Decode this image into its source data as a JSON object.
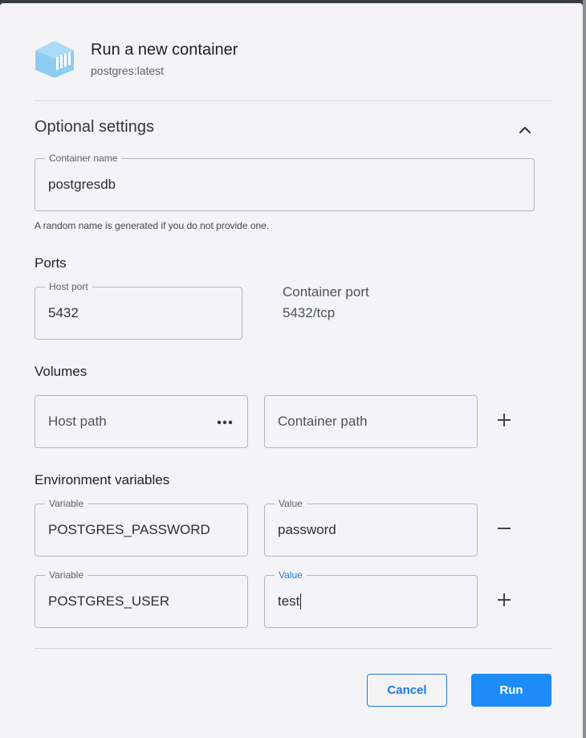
{
  "header": {
    "title": "Run a new container",
    "image": "postgres:latest",
    "icon": "container-icon"
  },
  "optional": {
    "heading": "Optional settings",
    "collapse_icon": "chevron-up-icon",
    "container_name": {
      "label": "Container name",
      "value": "postgresdb",
      "helper": "A random name is generated if you do not provide one."
    }
  },
  "ports": {
    "heading": "Ports",
    "host_port": {
      "label": "Host port",
      "value": "5432"
    },
    "container_port_label": "Container port",
    "container_port_value": "5432/tcp"
  },
  "volumes": {
    "heading": "Volumes",
    "host_path_placeholder": "Host path",
    "container_path_placeholder": "Container path",
    "browse_icon": "more-horizontal-icon",
    "add_icon": "plus-icon"
  },
  "env": {
    "heading": "Environment variables",
    "rows": [
      {
        "var_label": "Variable",
        "var_value": "POSTGRES_PASSWORD",
        "val_label": "Value",
        "val_value": "password",
        "action_icon": "minus-icon"
      },
      {
        "var_label": "Variable",
        "var_value": "POSTGRES_USER",
        "val_label": "Value",
        "val_value": "test",
        "action_icon": "plus-icon"
      }
    ]
  },
  "actions": {
    "cancel": "Cancel",
    "run": "Run"
  },
  "colors": {
    "accent": "#1d8cf8",
    "focus_label": "#1f7ae0",
    "logo": "#8ecdf2"
  }
}
